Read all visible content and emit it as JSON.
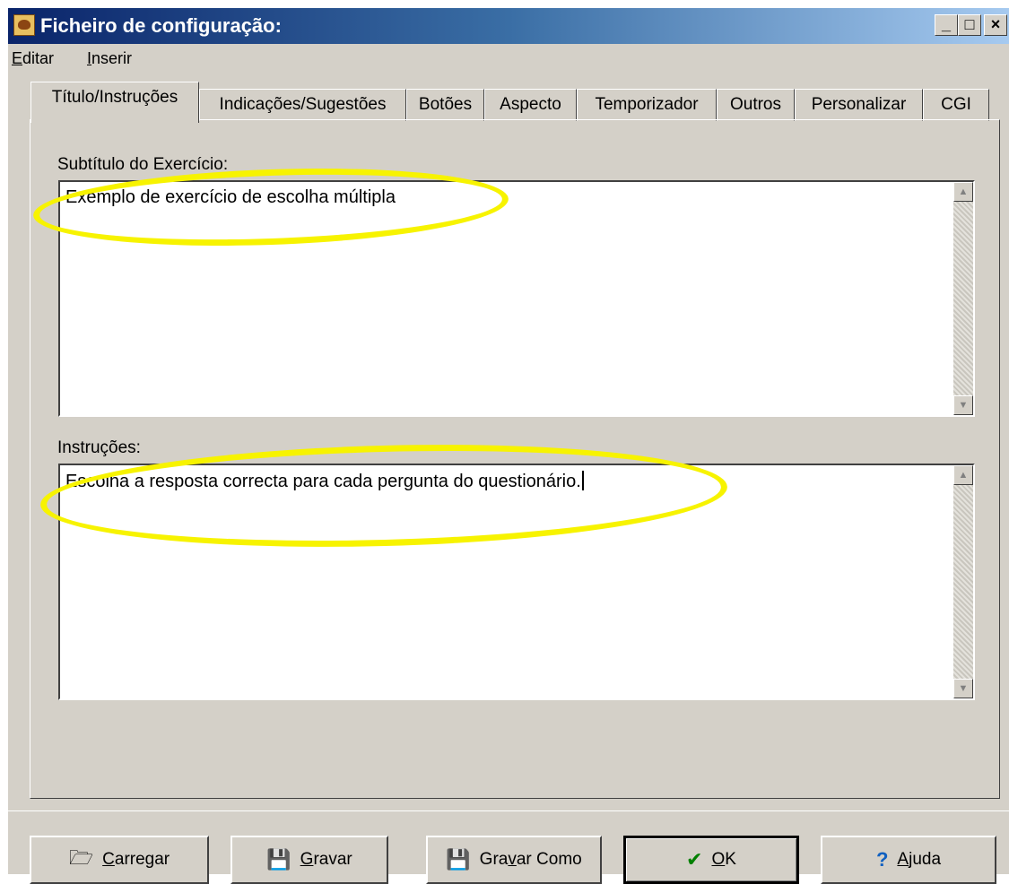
{
  "window": {
    "title": "Ficheiro de configuração:",
    "controls": {
      "minimize": "_",
      "maximize": "□",
      "close": "×"
    }
  },
  "menubar": [
    {
      "accel": "E",
      "rest": "ditar"
    },
    {
      "accel": "I",
      "rest": "nserir"
    }
  ],
  "tabs": [
    {
      "label": "Título/Instruções",
      "active": true
    },
    {
      "label": "Indicações/Sugestões"
    },
    {
      "label": "Botões"
    },
    {
      "label": "Aspecto"
    },
    {
      "label": "Temporizador"
    },
    {
      "label": "Outros"
    },
    {
      "label": "Personalizar"
    },
    {
      "label": "CGI"
    }
  ],
  "subtitle": {
    "label": "Subtítulo do Exercício:",
    "value": "Exemplo de exercício de escolha múltipla"
  },
  "instructions": {
    "label": "Instruções:",
    "value": "Escolha a resposta correcta para cada pergunta do questionário."
  },
  "buttons": [
    {
      "icon": "open-folder-icon",
      "glyph": "🗁",
      "pre": "",
      "accel": "C",
      "post": "arregar"
    },
    {
      "icon": "save-disk-icon",
      "glyph": "💾",
      "pre": "",
      "accel": "G",
      "post": "ravar"
    },
    {
      "icon": "save-as-icon",
      "glyph": "💾",
      "pre": "Gra",
      "accel": "v",
      "post": "ar Como"
    },
    {
      "icon": "checkmark-icon",
      "glyph": "✔",
      "pre": "",
      "accel": "O",
      "post": "K"
    },
    {
      "icon": "help-question-icon",
      "glyph": "?",
      "pre": "",
      "accel": "A",
      "post": "juda"
    }
  ],
  "colors": {
    "highlight": "#f7f300",
    "ok_check": "#008000",
    "help_icon": "#1060c0",
    "titlebar_start": "#0a246a",
    "titlebar_end": "#a6caf0"
  }
}
